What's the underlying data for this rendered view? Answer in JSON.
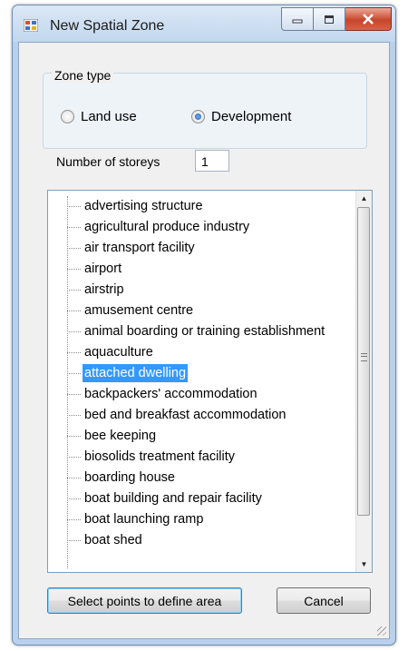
{
  "window": {
    "title": "New Spatial Zone",
    "icons": {
      "app": "app-window-icon",
      "minimize": "minimize-icon",
      "maximize": "maximize-icon",
      "close": "close-icon"
    }
  },
  "zone_type": {
    "label": "Zone type",
    "options": [
      {
        "label": "Land use",
        "checked": false
      },
      {
        "label": "Development",
        "checked": true
      }
    ]
  },
  "storeys": {
    "label": "Number of storeys",
    "value": "1"
  },
  "list": {
    "items": [
      "advertising structure",
      "agricultural produce industry",
      "air transport facility",
      "airport",
      "airstrip",
      "amusement centre",
      "animal boarding or training establishment",
      "aquaculture",
      "attached dwelling",
      "backpackers' accommodation",
      "bed and breakfast accommodation",
      "bee keeping",
      "biosolids treatment facility",
      "boarding house",
      "boat building and repair facility",
      "boat launching ramp",
      "boat shed"
    ],
    "selected": "attached dwelling"
  },
  "buttons": {
    "select_points": "Select points to define area",
    "cancel": "Cancel"
  },
  "colors": {
    "selection": "#3399ff",
    "title_bar": "#c2d7ee",
    "close_button": "#c8452b"
  }
}
